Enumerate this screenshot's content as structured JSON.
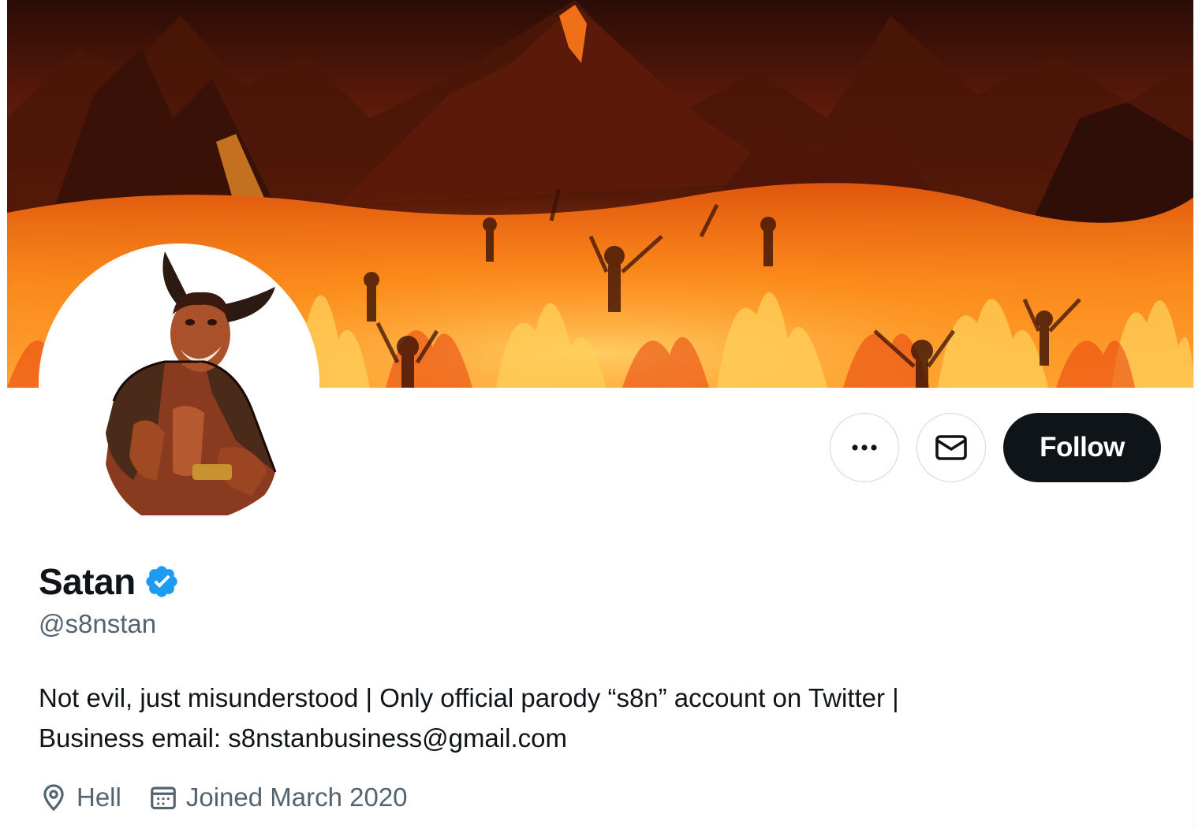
{
  "profile": {
    "display_name": "Satan",
    "verified": true,
    "handle": "@s8nstan",
    "bio_line1": "Not evil, just misunderstood | Only official parody “s8n” account on Twitter |",
    "bio_line2": "Business email: s8nstanbusiness@gmail.com",
    "location": "Hell",
    "joined": "Joined March 2020"
  },
  "actions": {
    "more_icon": "more-icon",
    "message_icon": "envelope-icon",
    "follow_label": "Follow"
  },
  "colors": {
    "text_primary": "#0f1419",
    "text_secondary": "#536471",
    "verified_badge": "#1d9bf0",
    "follow_button": "#0f1419",
    "border": "#cfd9de"
  }
}
